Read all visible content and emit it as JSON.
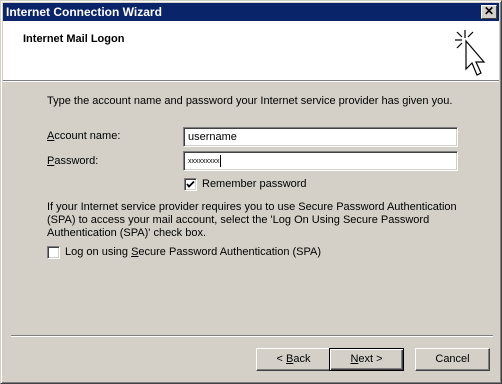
{
  "window": {
    "title": "Internet Connection Wizard",
    "close_glyph": "✕"
  },
  "header": {
    "title": "Internet Mail Logon",
    "icon": "wizard-sparkle-cursor-icon"
  },
  "form": {
    "intro": "Type the account name and password your Internet service provider has given you.",
    "account_label_accel": "A",
    "account_label_rest": "ccount name:",
    "account_value": "username",
    "password_label_accel": "P",
    "password_label_rest": "assword:",
    "password_mask": "xxxxxxxxx",
    "remember_label": "Remember password",
    "remember_checked": true,
    "spa_info": "If your Internet service provider requires you to use Secure Password Authentication (SPA) to access your mail account, select the 'Log On Using Secure Password Authentication (SPA)' check box.",
    "spa_label_pre": "Log on using ",
    "spa_label_accel": "S",
    "spa_label_post": "ecure Password Authentication (SPA)",
    "spa_checked": false
  },
  "buttons": {
    "back_prefix": "< ",
    "back_accel": "B",
    "back_rest": "ack",
    "next_accel": "N",
    "next_rest": "ext >",
    "cancel": "Cancel"
  }
}
